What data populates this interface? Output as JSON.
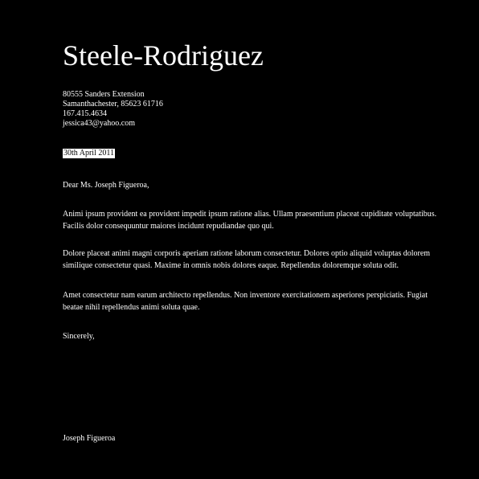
{
  "letter": {
    "company_name": "Steele-Rodriguez",
    "address": {
      "street": "80555 Sanders Extension",
      "city_line": "Samanthachester, 85623 61716",
      "phone": "167.415.4634",
      "email": "jessica43@yahoo.com"
    },
    "date": "30th April 2011",
    "salutation": "Dear Ms. Joseph Figueroa,",
    "paragraphs": [
      "Animi ipsum provident ea provident impedit ipsum ratione alias. Ullam praesentium placeat cupiditate voluptatibus. Facilis dolor consequuntur maiores incidunt repudiandae quo qui.",
      "Dolore placeat animi magni corporis aperiam ratione laborum consectetur. Dolores optio aliquid voluptas dolorem similique consectetur quasi. Maxime in omnis nobis dolores eaque. Repellendus doloremque soluta odit.",
      "Amet consectetur nam earum architecto repellendus. Non inventore exercitationem asperiores perspiciatis. Fugiat beatae nihil repellendus animi soluta quae."
    ],
    "closing": "Sincerely,",
    "signature_name": "Joseph Figueroa"
  },
  "colors": {
    "background": "#000000",
    "text": "#ffffff",
    "date_highlight_bg": "#ffffff",
    "date_highlight_text": "#000000"
  }
}
